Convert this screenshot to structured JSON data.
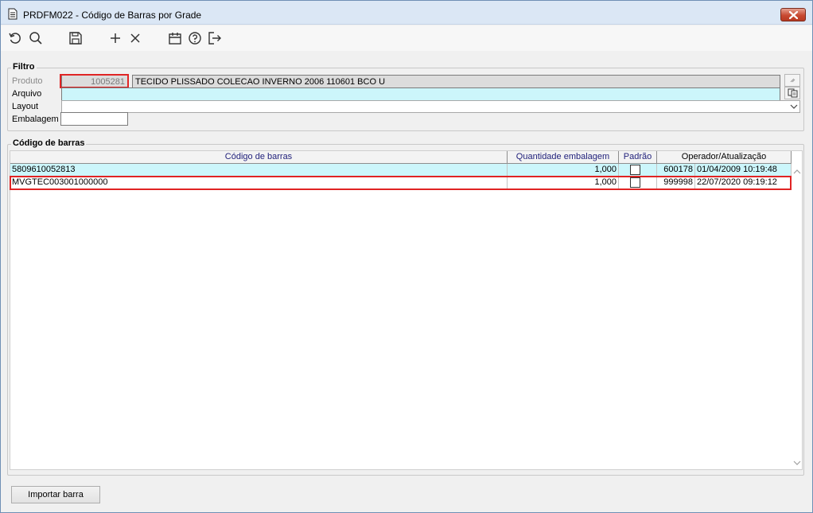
{
  "window": {
    "title": "PRDFM022 - Código de Barras por Grade"
  },
  "toolbar": {
    "buttons": [
      {
        "icon": "undo-icon"
      },
      {
        "icon": "search-icon"
      },
      {
        "icon": "save-icon"
      },
      {
        "icon": "add-icon"
      },
      {
        "icon": "delete-icon"
      },
      {
        "icon": "calendar-icon"
      },
      {
        "icon": "help-icon"
      },
      {
        "icon": "exit-icon"
      }
    ]
  },
  "filtro": {
    "legend": "Filtro",
    "produto_label": "Produto",
    "produto_code": "1005281",
    "produto_desc": "TECIDO PLISSADO COLECAO INVERNO 2006 110601 BCO U",
    "arquivo_label": "Arquivo",
    "arquivo_value": "",
    "layout_label": "Layout",
    "layout_value": "",
    "embalagem_label": "Embalagem",
    "embalagem_value": ""
  },
  "barcodes": {
    "legend": "Código de barras",
    "columns": [
      "Código de barras",
      "Quantidade embalagem",
      "Padrão",
      "Operador/Atualização"
    ],
    "rows": [
      {
        "codigo": "5809610052813",
        "quantidade": "1,000",
        "padrao": false,
        "operador": "600178",
        "atualizacao": "01/04/2009 10:19:48"
      },
      {
        "codigo": "MVGTEC003001000000",
        "quantidade": "1,000",
        "padrao": false,
        "operador": "999998",
        "atualizacao": "22/07/2020 09:19:12"
      }
    ]
  },
  "footer": {
    "import_label": "Importar barra"
  },
  "colors": {
    "selected_row": "#ccf6fb",
    "highlight": "#e02424",
    "header_text": "#1f1f7a"
  }
}
